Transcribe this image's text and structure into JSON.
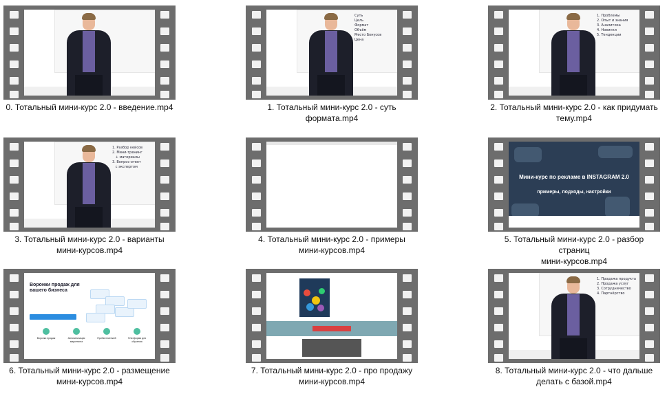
{
  "items": [
    {
      "caption_line1": "0. Тотальный мини-курс 2.0 - введение.mp4",
      "caption_line2": "",
      "scene": "person",
      "board_notes": ""
    },
    {
      "caption_line1": "1. Тотальный мини-курс 2.0 - суть",
      "caption_line2": "формата.mp4",
      "scene": "person",
      "board_notes": "Суть\nЦель\nФормат\nОбъём\nМесто Бонусов\nЦена"
    },
    {
      "caption_line1": "2. Тотальный мини-курс 2.0 - как придумать",
      "caption_line2": "тему.mp4",
      "scene": "person",
      "board_notes": "1. Проблемы\n2. Опыт и знания\n3. Аналитика\n4. Новинки\n5. Тенденции"
    },
    {
      "caption_line1": "3. Тотальный мини-курс 2.0 - варианты",
      "caption_line2": "мини-курсов.mp4",
      "scene": "person",
      "board_notes": "1. Разбор кейсов\n2. Мини-тренинг\n   + материалы\n3. Вопрос-ответ\n   с экспертом"
    },
    {
      "caption_line1": "4. Тотальный мини-курс 2.0 - примеры",
      "caption_line2": "мини-курсов.mp4",
      "scene": "blank",
      "board_notes": ""
    },
    {
      "caption_line1": "5. Тотальный мини-курс 2.0 - разбор страниц",
      "caption_line2": "мини-курсов.mp4",
      "scene": "insta",
      "board_notes": "",
      "heading": "Мини-курс по рекламе в INSTAGRAM 2.0",
      "subheading": "примеры, подходы, настройки"
    },
    {
      "caption_line1": "6. Тотальный мини-курс 2.0 - размещение",
      "caption_line2": "мини-курсов.mp4",
      "scene": "landing",
      "board_notes": "",
      "heading": "Воронки продаж для вашего бизнеса",
      "features": [
        "Воронки продаж",
        "Автоматизация маркетинга",
        "Приём платежей",
        "Платформа для обучения"
      ]
    },
    {
      "caption_line1": "7. Тотальный мини-курс 2.0 - про продажу",
      "caption_line2": "мини-курсов.mp4",
      "scene": "sales",
      "board_notes": ""
    },
    {
      "caption_line1": "8. Тотальный мини-курс 2.0 - что дальше",
      "caption_line2": "делать с базой.mp4",
      "scene": "person",
      "board_notes": "1. Продажа продукта\n2. Продажа услуг\n3. Сотрудничество\n4. Партнёрство"
    }
  ],
  "colors": {
    "filmstrip": "#6d6d6d",
    "perforation": "#f2f2f2",
    "caption_text": "#111111",
    "background": "#ffffff"
  }
}
